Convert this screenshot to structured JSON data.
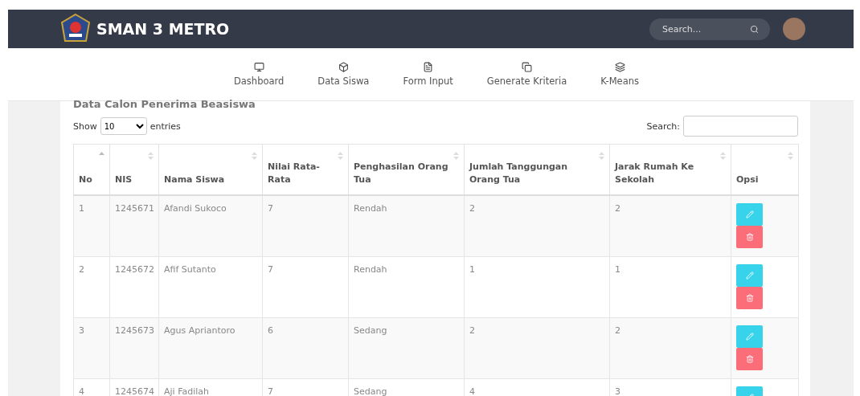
{
  "header": {
    "brand": "SMAN 3 METRO",
    "search": {
      "placeholder": "Search..."
    }
  },
  "nav": [
    {
      "label": "Dashboard"
    },
    {
      "label": "Data Siswa"
    },
    {
      "label": "Form Input"
    },
    {
      "label": "Generate Kriteria"
    },
    {
      "label": "K-Means"
    }
  ],
  "panel": {
    "title": "Data Calon Penerima Beasiswa",
    "length": {
      "before": "Show",
      "value": "10",
      "after": "entries"
    },
    "search": {
      "label": "Search:"
    }
  },
  "table": {
    "columns": [
      {
        "label": "No",
        "sorted": true
      },
      {
        "label": "NIS",
        "sorted": false
      },
      {
        "label": "Nama Siswa",
        "sorted": false
      },
      {
        "label": "Nilai Rata-Rata",
        "sorted": false
      },
      {
        "label": "Penghasilan Orang Tua",
        "sorted": false
      },
      {
        "label": "Jumlah Tanggungan Orang Tua",
        "sorted": false
      },
      {
        "label": "Jarak Rumah Ke Sekolah",
        "sorted": false
      },
      {
        "label": "Opsi",
        "sorted": false
      }
    ],
    "rows": [
      {
        "cells": [
          "1",
          "1245671",
          "Afandi Sukoco",
          "7",
          "Rendah",
          "2",
          "2"
        ],
        "actions": [
          {
            "kind": "edit"
          },
          {
            "kind": "delete"
          }
        ]
      },
      {
        "cells": [
          "2",
          "1245672",
          "Afif Sutanto",
          "7",
          "Rendah",
          "1",
          "1"
        ],
        "actions": [
          {
            "kind": "edit"
          },
          {
            "kind": "delete"
          }
        ]
      },
      {
        "cells": [
          "3",
          "1245673",
          "Agus Apriantoro",
          "6",
          "Sedang",
          "2",
          "2"
        ],
        "actions": [
          {
            "kind": "edit"
          },
          {
            "kind": "delete"
          }
        ]
      },
      {
        "cells": [
          "4",
          "1245674",
          "Aji Fadilah",
          "7",
          "Sedang",
          "4",
          "3"
        ],
        "actions": [
          {
            "kind": "edit"
          }
        ]
      }
    ]
  }
}
